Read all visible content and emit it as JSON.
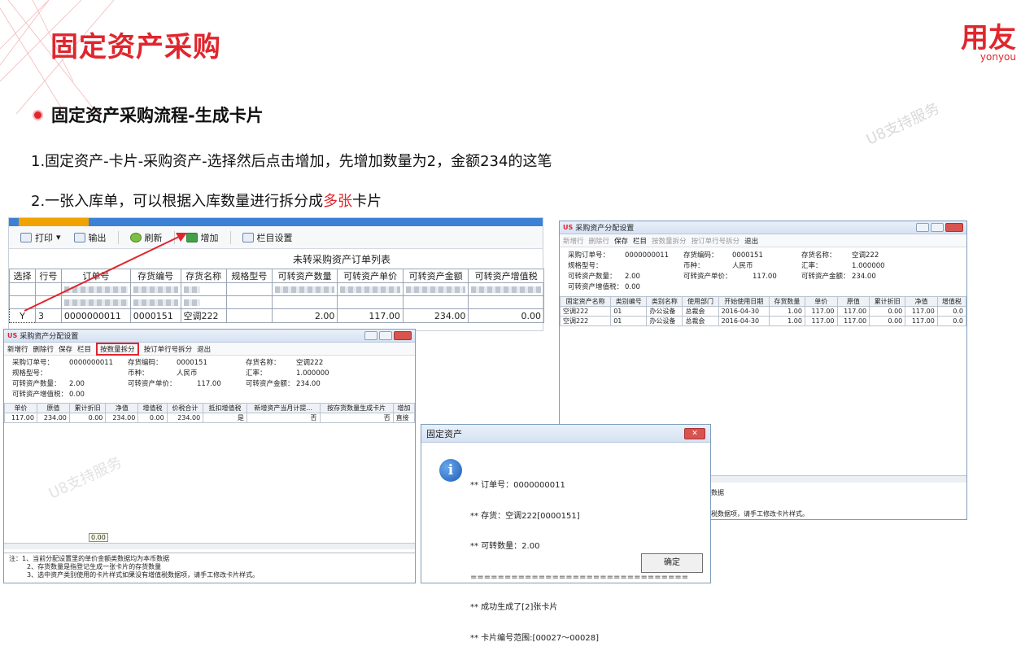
{
  "slide": {
    "title": "固定资产采购",
    "logo": {
      "main": "用友",
      "sub": "yonyou"
    },
    "watermark": "U8支持服务",
    "subheading": "固定资产采购流程-生成卡片",
    "step1": "1.固定资产-卡片-采购资产-选择然后点击增加，先增加数量为2，金额234的这笔",
    "step2_prefix": "2.一张入库单，可以根据入库数量进行拆分成",
    "step2_red": "多张",
    "step2_suffix": "卡片"
  },
  "colors": {
    "brand_red": "#e0262d",
    "window_blue": "#3b82d6"
  },
  "list_window": {
    "toolbar": {
      "print": "打印",
      "export": "输出",
      "refresh": "刷新",
      "add": "增加",
      "columns": "栏目设置"
    },
    "title": "未转采购资产订单列表",
    "headers": [
      "选择",
      "行号",
      "订单号",
      "存货编号",
      "存货名称",
      "规格型号",
      "可转资产数量",
      "可转资产单价",
      "可转资产金额",
      "可转资产增值税"
    ],
    "row_selected": {
      "select": "Y",
      "line": "3",
      "order": "0000000011",
      "inv_code": "0000151",
      "inv_name": "空调222",
      "spec": "",
      "qty": "2.00",
      "price": "117.00",
      "amount": "234.00",
      "tax": "0.00"
    }
  },
  "split_window": {
    "title": "采购资产分配设置",
    "toolbar": {
      "add_row": "新增行",
      "del_row": "删除行",
      "save": "保存",
      "columns": "栏目",
      "split_qty": "按数量拆分",
      "split_order": "按订单行号拆分",
      "exit": "退出"
    },
    "fields": {
      "order_no_label": "采购订单号：",
      "order_no": "0000000011",
      "inv_code_label": "存货编码：",
      "inv_code": "0000151",
      "inv_name_label": "存货名称：",
      "inv_name": "空调222",
      "spec_label": "规格型号：",
      "currency_label": "币种：",
      "currency": "人民币",
      "rate_label": "汇率：",
      "rate": "1.000000",
      "qty_label": "可转资产数量：",
      "qty": "2.00",
      "price_label": "可转资产单价：",
      "price": "117.00",
      "amount_label": "可转资产金额：",
      "amount": "234.00",
      "tax_label": "可转资产增值税：",
      "tax": "0.00"
    },
    "headers": [
      "单价",
      "原值",
      "累计折旧",
      "净值",
      "增值税",
      "价税合计",
      "抵扣增值税",
      "新增资产当月计提...",
      "按存货数量生成卡片",
      "增加"
    ],
    "row": [
      "117.00",
      "234.00",
      "0.00",
      "234.00",
      "0.00",
      "234.00",
      "是",
      "否",
      "否",
      "直接"
    ],
    "sum_cell": "0.00",
    "notes": [
      "注：1、当前分配设置里的单价金额类数据均为本币数据",
      "2、存货数量是指登记生成一张卡片的存货数量",
      "3、选中资产类别使用的卡片样式如果没有增值税数据项，请手工修改卡片样式。"
    ]
  },
  "result_window": {
    "title": "采购资产分配设置",
    "headers": [
      "固定资产名称",
      "类别编号",
      "类别名称",
      "使用部门",
      "开始使用日期",
      "存货数量",
      "单价",
      "原值",
      "累计折旧",
      "净值",
      "增值税"
    ],
    "rows": [
      [
        "空调222",
        "01",
        "办公设备",
        "总裁会",
        "2016-04-30",
        "1.00",
        "117.00",
        "117.00",
        "0.00",
        "117.00",
        "0.0"
      ],
      [
        "空调222",
        "01",
        "办公设备",
        "总裁会",
        "2016-04-30",
        "1.00",
        "117.00",
        "117.00",
        "0.00",
        "117.00",
        "0.0"
      ]
    ],
    "note_partial1": "数据",
    "note_partial2": "税数据项，请手工修改卡片样式。"
  },
  "message_box": {
    "title": "固定资产",
    "lines": [
      "** 订单号：0000000011",
      "** 存货：空调222[0000151]",
      "** 可转数量：2.00",
      "================================",
      "** 成功生成了[2]张卡片",
      "** 卡片编号范围:[00027～00028]"
    ],
    "ok": "确定"
  }
}
